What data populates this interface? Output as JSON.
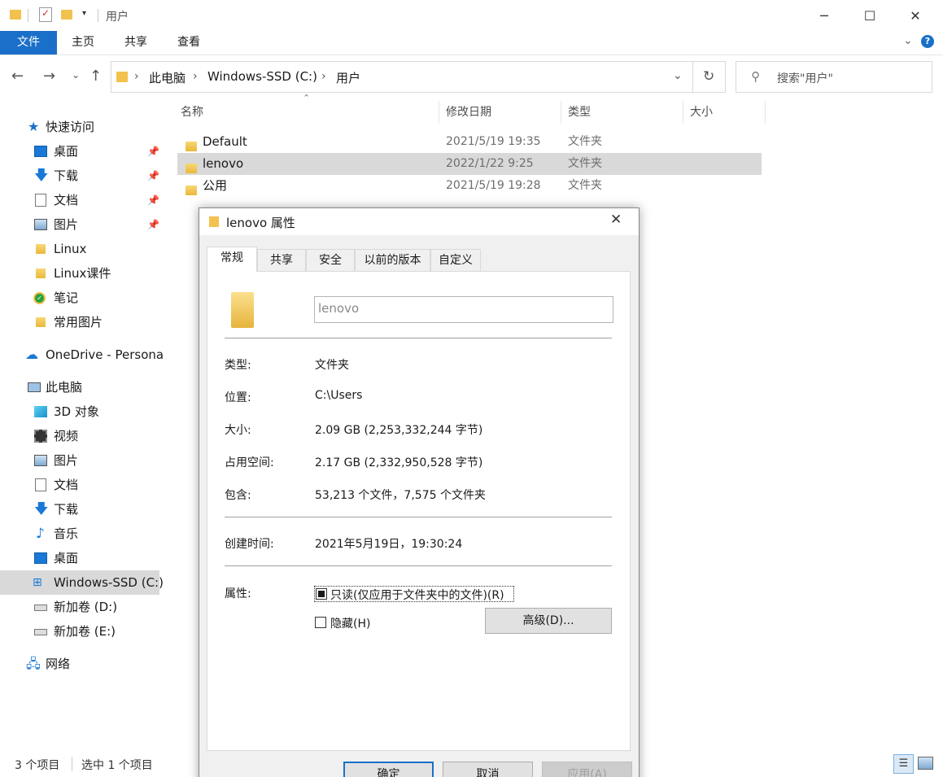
{
  "window": {
    "title": "用户",
    "minimize_icon": "─",
    "maximize_icon": "☐",
    "close_icon": "✕"
  },
  "ribbon": {
    "tabs": [
      "文件",
      "主页",
      "共享",
      "查看"
    ]
  },
  "address": {
    "breadcrumbs": [
      "此电脑",
      "Windows-SSD (C:)",
      "用户"
    ],
    "search_placeholder": "搜索\"用户\""
  },
  "nav": {
    "quick_access": "快速访问",
    "pinned": [
      {
        "label": "桌面",
        "icon": "desktop-icon"
      },
      {
        "label": "下载",
        "icon": "download-icon"
      },
      {
        "label": "文档",
        "icon": "document-icon"
      },
      {
        "label": "图片",
        "icon": "picture-icon"
      }
    ],
    "folders": [
      "Linux",
      "Linux课件",
      "笔记",
      "常用图片"
    ],
    "onedrive": "OneDrive - Persona",
    "this_pc": "此电脑",
    "pc_items": [
      "3D 对象",
      "视频",
      "图片",
      "文档",
      "下载",
      "音乐",
      "桌面",
      "Windows-SSD (C:)",
      "新加卷 (D:)",
      "新加卷 (E:)"
    ],
    "network": "网络"
  },
  "columns": {
    "name": "名称",
    "modified": "修改日期",
    "type": "类型",
    "size": "大小"
  },
  "files": [
    {
      "name": "Default",
      "modified": "2021/5/19 19:35",
      "type": "文件夹"
    },
    {
      "name": "lenovo",
      "modified": "2022/1/22 9:25",
      "type": "文件夹"
    },
    {
      "name": "公用",
      "modified": "2021/5/19 19:28",
      "type": "文件夹"
    }
  ],
  "status": {
    "count": "3 个项目",
    "selected": "选中 1 个项目"
  },
  "dialog": {
    "title": "lenovo 属性",
    "tabs": [
      "常规",
      "共享",
      "安全",
      "以前的版本",
      "自定义"
    ],
    "name_value": "lenovo",
    "labels": {
      "type": "类型:",
      "location": "位置:",
      "size": "大小:",
      "size_on_disk": "占用空间:",
      "contains": "包含:",
      "created": "创建时间:",
      "attributes": "属性:"
    },
    "values": {
      "type": "文件夹",
      "location": "C:\\Users",
      "size": "2.09 GB (2,253,332,244 字节)",
      "size_on_disk": "2.17 GB (2,332,950,528 字节)",
      "contains": "53,213 个文件，7,575 个文件夹",
      "created": "2021年5月19日，19:30:24"
    },
    "readonly_label": "只读(仅应用于文件夹中的文件)(R)",
    "hidden_label": "隐藏(H)",
    "advanced_button": "高级(D)...",
    "ok_button": "确定",
    "cancel_button": "取消",
    "apply_button": "应用(A)"
  }
}
